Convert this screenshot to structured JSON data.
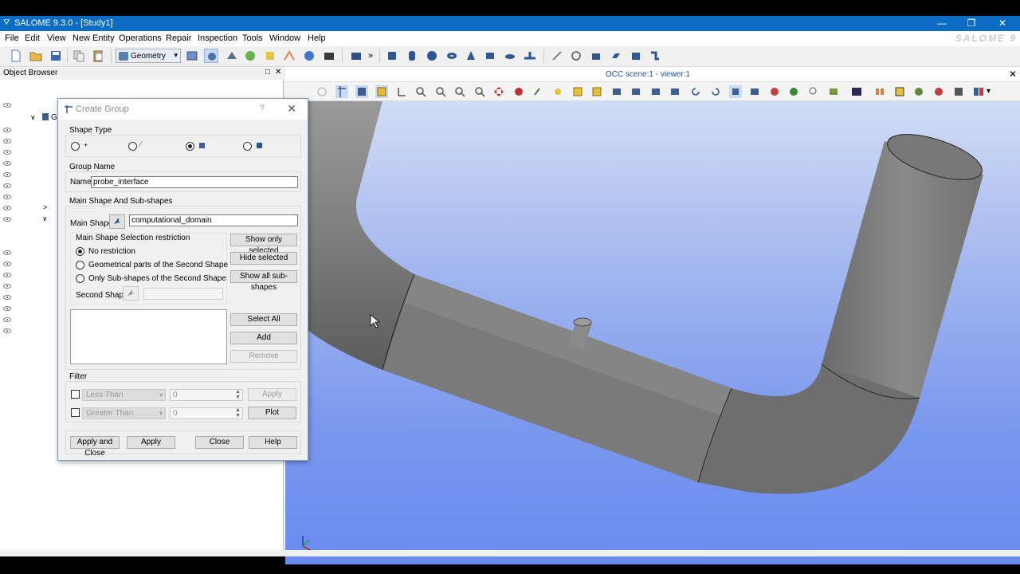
{
  "window": {
    "title": "SALOME 9.3.0 - [Study1]",
    "logo": "SALOME 9"
  },
  "menu": [
    "File",
    "Edit",
    "View",
    "New Entity",
    "Operations",
    "Repair",
    "Inspection",
    "Tools",
    "Window",
    "Help"
  ],
  "toolbar": {
    "module": "Geometry",
    "more": "»"
  },
  "object_browser": {
    "title": "Object Browser",
    "tree_fragment": "G"
  },
  "viewer": {
    "title": "OCC scene:1 - viewer:1",
    "more": "▾"
  },
  "dialog": {
    "title": "Create Group",
    "help_glyph": "?",
    "shape_type": {
      "title": "Shape Type",
      "options": [
        {
          "icon": "vertex-icon",
          "selected": false
        },
        {
          "icon": "edge-icon",
          "selected": false
        },
        {
          "icon": "face-icon",
          "selected": true
        },
        {
          "icon": "solid-icon",
          "selected": false
        }
      ]
    },
    "group_name": {
      "title": "Group Name",
      "label": "Name",
      "value": "probe_interface"
    },
    "main_shape": {
      "title": "Main Shape And Sub-shapes",
      "label": "Main Shape",
      "value": "computational_domain",
      "restriction_title": "Main Shape Selection restriction",
      "restrictions": [
        {
          "label": "No restriction",
          "selected": true
        },
        {
          "label": "Geometrical parts of the Second Shape",
          "selected": false
        },
        {
          "label": "Only Sub-shapes of the Second Shape",
          "selected": false
        }
      ],
      "second_shape_label": "Second Shape",
      "second_shape_value": "",
      "buttons": {
        "show_only_selected": "Show only selected",
        "hide_selected": "Hide selected",
        "show_all": "Show all sub-shapes"
      }
    },
    "list_buttons": {
      "select_all": "Select All",
      "add": "Add",
      "remove": "Remove"
    },
    "filter": {
      "title": "Filter",
      "rows": [
        {
          "combo": "Less Than",
          "value": "0",
          "button": "Apply"
        },
        {
          "combo": "Greater Than",
          "value": "0",
          "button": "Plot"
        }
      ]
    },
    "footer": {
      "apply_close": "Apply and Close",
      "apply": "Apply",
      "close": "Close",
      "help": "Help"
    }
  }
}
